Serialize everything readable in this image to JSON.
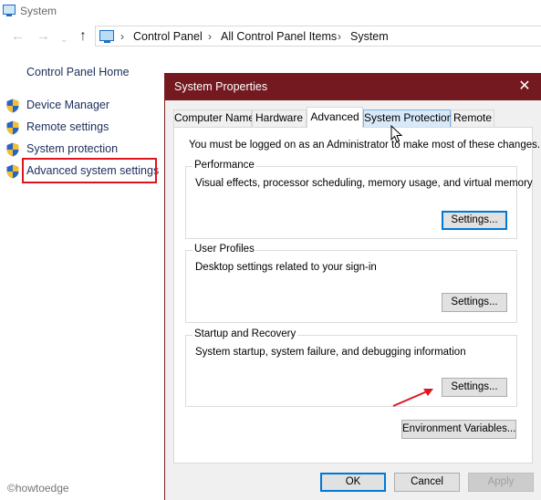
{
  "window": {
    "title": "System",
    "breadcrumbs": [
      "Control Panel",
      "All Control Panel Items",
      "System"
    ]
  },
  "sidebar": {
    "home": "Control Panel Home",
    "items": [
      {
        "label": "Device Manager",
        "icon": "uac-shield-icon"
      },
      {
        "label": "Remote settings",
        "icon": "uac-shield-icon"
      },
      {
        "label": "System protection",
        "icon": "uac-shield-icon"
      },
      {
        "label": "Advanced system settings",
        "icon": "uac-shield-icon",
        "highlighted": true
      }
    ]
  },
  "dialog": {
    "title": "System Properties",
    "close_glyph": "✕",
    "tabs": [
      {
        "label": "Computer Name",
        "active": false
      },
      {
        "label": "Hardware",
        "active": false
      },
      {
        "label": "Advanced",
        "active": true
      },
      {
        "label": "System Protection",
        "active": false,
        "hover": true
      },
      {
        "label": "Remote",
        "active": false
      }
    ],
    "admin_note": "You must be logged on as an Administrator to make most of these changes.",
    "groups": [
      {
        "title": "Performance",
        "description": "Visual effects, processor scheduling, memory usage, and virtual memory",
        "button": "Settings..."
      },
      {
        "title": "User Profiles",
        "description": "Desktop settings related to your sign-in",
        "button": "Settings..."
      },
      {
        "title": "Startup and Recovery",
        "description": "System startup, system failure, and debugging information",
        "button": "Settings..."
      }
    ],
    "env_button": "Environment Variables...",
    "ok": "OK",
    "cancel": "Cancel",
    "apply": "Apply"
  },
  "watermark": "©howtoedge",
  "colors": {
    "dialog_title_bar": "#73191f",
    "highlight_box": "#e0141d",
    "link_text": "#1b2e5b",
    "focus_border": "#0078d7"
  }
}
